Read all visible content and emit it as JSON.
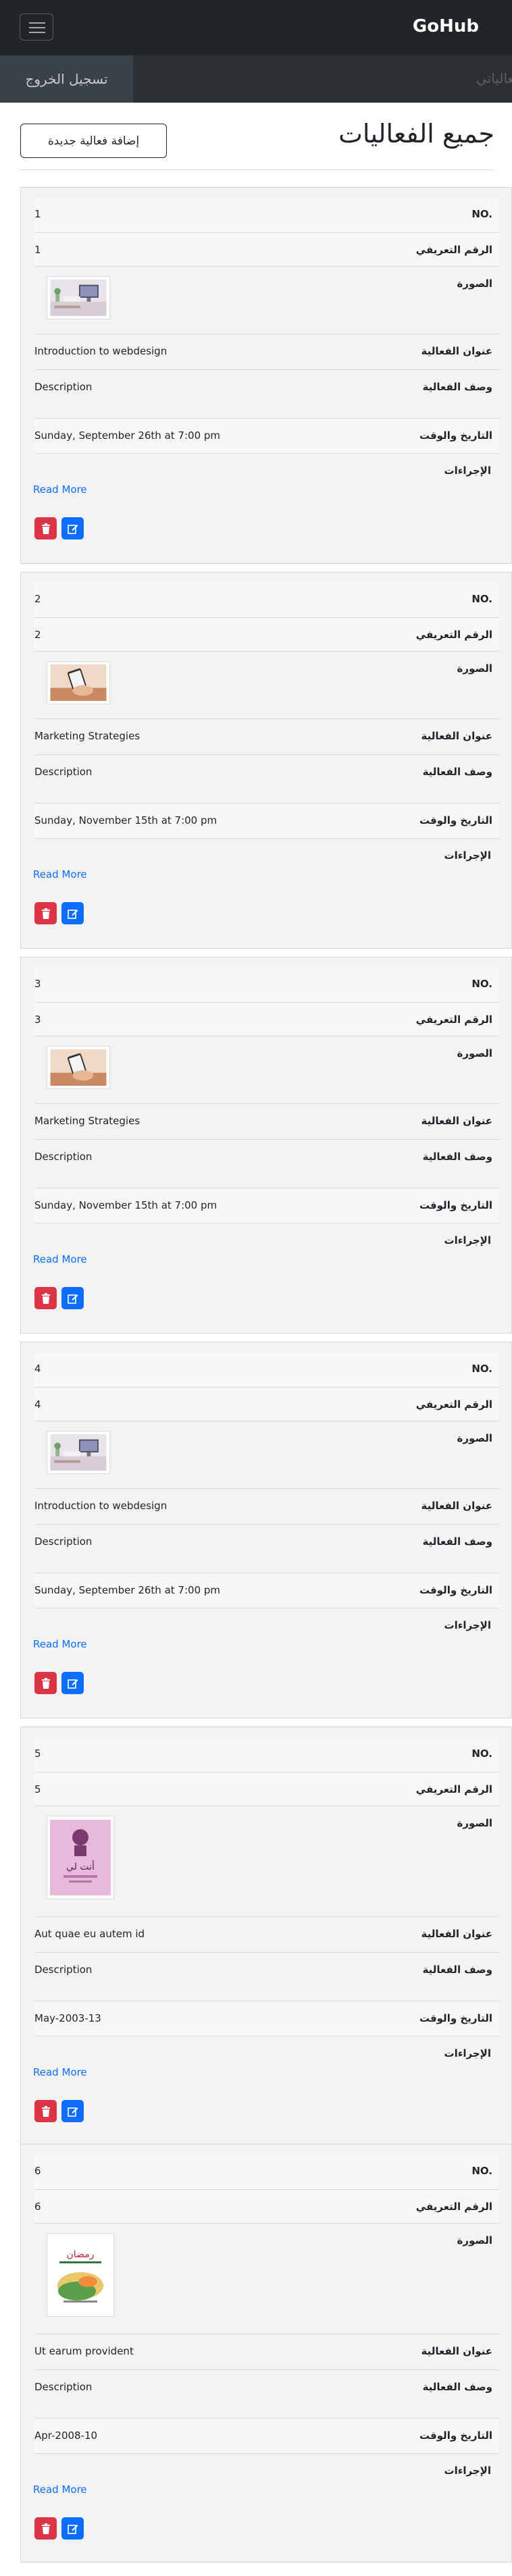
{
  "navbar": {
    "brand": "GoHub",
    "toggler_icon": "hamburger-icon",
    "logout_label": "تسجيل الخروج",
    "partial_link": "فعالياتي"
  },
  "header": {
    "title": "جميع الفعاليات",
    "add_button": "إضافة فعالية جديدة"
  },
  "labels": {
    "no": "NO.",
    "id": "الرقم التعريفي",
    "image": "الصورة",
    "title": "عنوان الفعالية",
    "description": "وصف الفعالية",
    "datetime": "التاريخ والوقت",
    "actions": "الإجراءات",
    "read_more": "Read More"
  },
  "colors": {
    "navbar_bg": "#212529",
    "danger": "#dc3545",
    "primary": "#0d6efd"
  },
  "events": [
    {
      "no": "1",
      "id": "1",
      "image": "workspace-photo",
      "title": "Introduction to webdesign",
      "description": "Description",
      "datetime": "Sunday, September 26th at 7:00 pm"
    },
    {
      "no": "2",
      "id": "2",
      "image": "hand-phone-photo",
      "title": "Marketing Strategies",
      "description": "Description",
      "datetime": "Sunday, November 15th at 7:00 pm"
    },
    {
      "no": "3",
      "id": "3",
      "image": "hand-phone-photo",
      "title": "Marketing Strategies",
      "description": "Description",
      "datetime": "Sunday, November 15th at 7:00 pm"
    },
    {
      "no": "4",
      "id": "4",
      "image": "workspace-photo",
      "title": "Introduction to webdesign",
      "description": "Description",
      "datetime": "Sunday, September 26th at 7:00 pm"
    },
    {
      "no": "5",
      "id": "5",
      "image": "pink-poster",
      "poster_text": "أنت لي",
      "title": "Aut quae eu autem id",
      "description": "Description",
      "datetime": "May-2003-13"
    },
    {
      "no": "6",
      "id": "6",
      "image": "arabic-calligraphy-poster",
      "poster_text": "رمضان",
      "title": "Ut earum provident",
      "description": "Description",
      "datetime": "Apr-2008-10"
    }
  ]
}
